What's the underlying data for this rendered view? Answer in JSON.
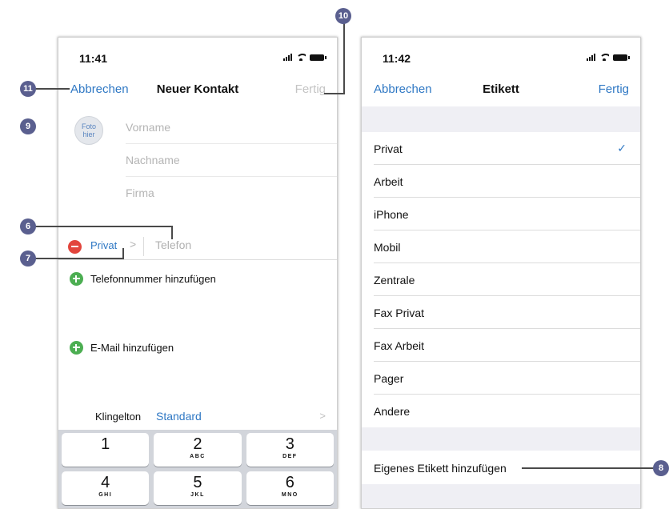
{
  "left_screen": {
    "status_time": "11:41",
    "nav": {
      "cancel": "Abbrechen",
      "title": "Neuer Kontakt",
      "done": "Fertig"
    },
    "photo_text": "Foto hier",
    "fields": {
      "first_name_placeholder": "Vorname",
      "last_name_placeholder": "Nachname",
      "company_placeholder": "Firma"
    },
    "phone_entry": {
      "label": "Privat",
      "chevron": ">",
      "placeholder": "Telefon"
    },
    "add_phone": "Telefonnummer hinzufügen",
    "add_email": "E-Mail hinzufügen",
    "ringtone": {
      "label": "Klingelton",
      "value": "Standard",
      "chevron": ">"
    },
    "keypad": [
      {
        "digit": "1",
        "letters": ""
      },
      {
        "digit": "2",
        "letters": "ABC"
      },
      {
        "digit": "3",
        "letters": "DEF"
      },
      {
        "digit": "4",
        "letters": "GHI"
      },
      {
        "digit": "5",
        "letters": "JKL"
      },
      {
        "digit": "6",
        "letters": "MNO"
      }
    ]
  },
  "right_screen": {
    "status_time": "11:42",
    "nav": {
      "cancel": "Abbrechen",
      "title": "Etikett",
      "done": "Fertig"
    },
    "labels": [
      "Privat",
      "Arbeit",
      "iPhone",
      "Mobil",
      "Zentrale",
      "Fax Privat",
      "Fax Arbeit",
      "Pager",
      "Andere"
    ],
    "selected_label": "Privat",
    "checkmark": "✓",
    "add_custom": "Eigenes Etikett hinzufügen"
  },
  "callouts": {
    "c6": "6",
    "c7": "7",
    "c8": "8",
    "c9": "9",
    "c10": "10",
    "c11": "11"
  },
  "colors": {
    "accent": "#2f78c4",
    "callout": "#5a5f8f",
    "minus": "#e2453c",
    "plus": "#4cae52"
  }
}
